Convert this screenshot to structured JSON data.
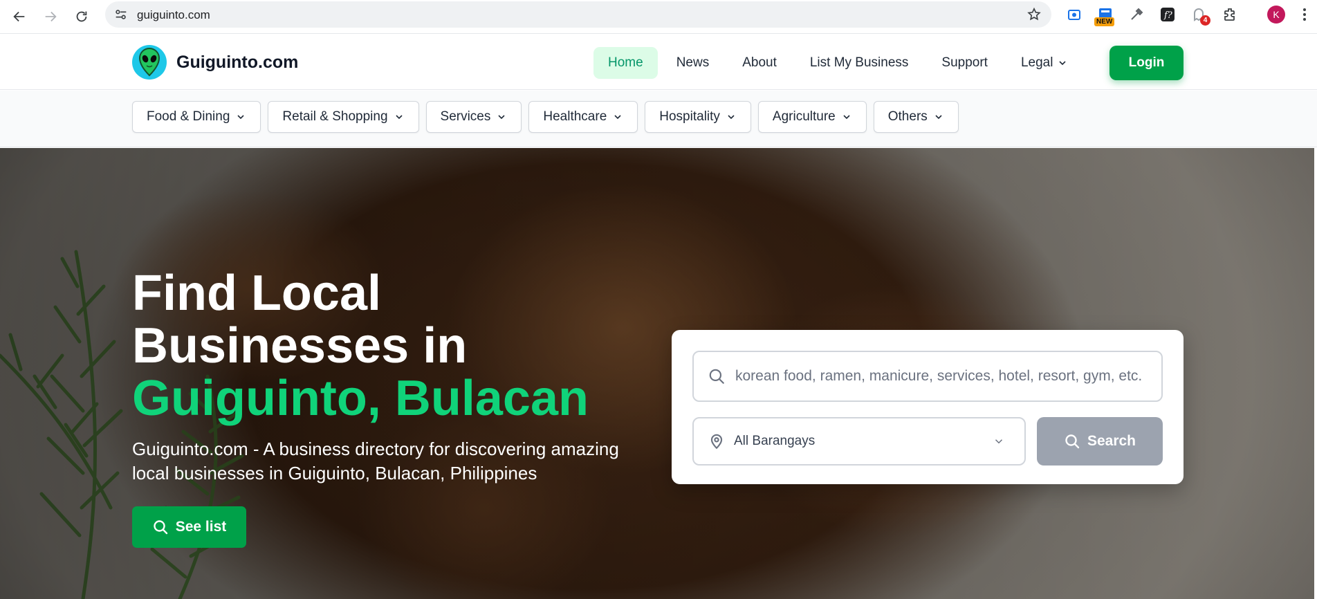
{
  "browser": {
    "url": "guiguinto.com",
    "extensions": [
      {
        "name": "screen-capture-extension-icon"
      },
      {
        "name": "new-extension-icon",
        "badge": "NEW"
      },
      {
        "name": "eyedropper-extension-icon"
      },
      {
        "name": "fonts-extension-icon"
      },
      {
        "name": "ghost-extension-icon",
        "badge": "4"
      },
      {
        "name": "extensions-puzzle-icon"
      }
    ],
    "profile_initial": "K",
    "profile_color": "#c2185b"
  },
  "header": {
    "brand": "Guiguinto.com",
    "nav": [
      {
        "label": "Home",
        "active": true
      },
      {
        "label": "News"
      },
      {
        "label": "About"
      },
      {
        "label": "List My Business"
      },
      {
        "label": "Support"
      },
      {
        "label": "Legal",
        "dropdown": true
      }
    ],
    "login_label": "Login"
  },
  "categories": [
    {
      "label": "Food & Dining"
    },
    {
      "label": "Retail & Shopping"
    },
    {
      "label": "Services"
    },
    {
      "label": "Healthcare"
    },
    {
      "label": "Hospitality"
    },
    {
      "label": "Agriculture"
    },
    {
      "label": "Others"
    }
  ],
  "hero": {
    "title_line1": "Find Local",
    "title_line2": "Businesses in",
    "title_accent": "Guiguinto, Bulacan",
    "subtitle": "Guiguinto.com - A business directory for discovering amazing local businesses in Guiguinto, Bulacan, Philippines",
    "cta_label": "See list"
  },
  "search": {
    "placeholder": "korean food, ramen, manicure, services, hotel, resort, gym, etc.",
    "barangay_selected": "All Barangays",
    "button_label": "Search"
  },
  "colors": {
    "brand_green": "#00a149",
    "accent_green": "#10d37a",
    "active_nav_bg": "#dcfce7",
    "search_button_disabled": "#9ca3af"
  }
}
